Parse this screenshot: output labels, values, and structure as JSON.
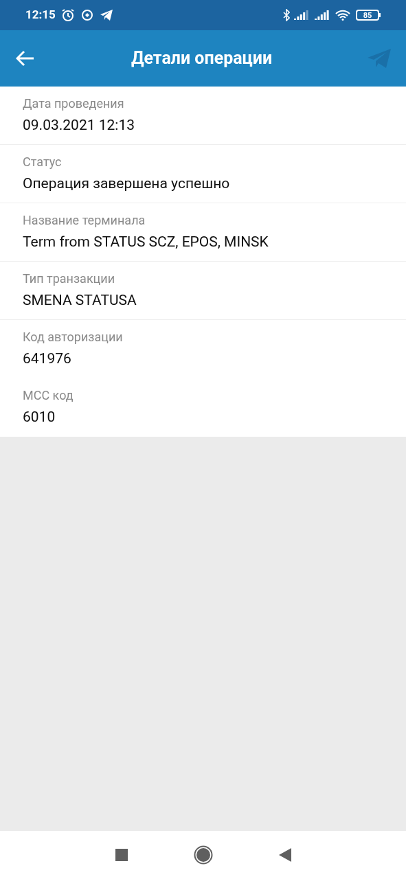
{
  "status_bar": {
    "time": "12:15",
    "battery": "85"
  },
  "header": {
    "title": "Детали операции"
  },
  "details": [
    {
      "label": "Дата проведения",
      "value": "09.03.2021 12:13",
      "divider": true
    },
    {
      "label": "Статус",
      "value": "Операция завершена успешно",
      "divider": true
    },
    {
      "label": "Название терминала",
      "value": "Term from STATUS SCZ, EPOS, MINSK",
      "divider": true
    },
    {
      "label": "Тип транзакции",
      "value": "SMENA STATUSA",
      "divider": true
    },
    {
      "label": "Код авторизации",
      "value": "641976",
      "divider": false
    },
    {
      "label": "MCC код",
      "value": "6010",
      "divider": false
    }
  ]
}
